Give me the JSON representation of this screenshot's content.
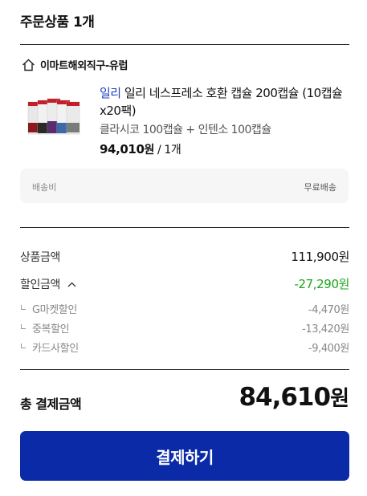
{
  "order": {
    "section_title": "주문상품 1개",
    "store_icon": "home-icon",
    "store_name": "이마트해외직구-유럽",
    "product": {
      "brand": "일리",
      "name": " 일리 네스프레소 호환 캡슐 200캡슐 (10캡슐x20팩)",
      "option": "클라시코 100캡슐 + 인텐소 100캡슐",
      "price": "94,010",
      "price_unit": "원",
      "quantity": " / 1개"
    },
    "shipping": {
      "label": "배송비",
      "value": "무료배송"
    }
  },
  "summary": {
    "goods_label": "상품금액",
    "goods_value": "111,900원",
    "discount_label": "할인금액",
    "discount_value": "-27,290원",
    "discount_color": "#1aa51a",
    "discounts": [
      {
        "label": "G마켓할인",
        "value": "-4,470원"
      },
      {
        "label": "중복할인",
        "value": "-13,420원"
      },
      {
        "label": "카드사할인",
        "value": "-9,400원"
      }
    ]
  },
  "total": {
    "label": "총 결제금액",
    "amount": "84,610",
    "unit": "원"
  },
  "pay_button": {
    "label": "결제하기",
    "color": "#0a2aa8"
  }
}
